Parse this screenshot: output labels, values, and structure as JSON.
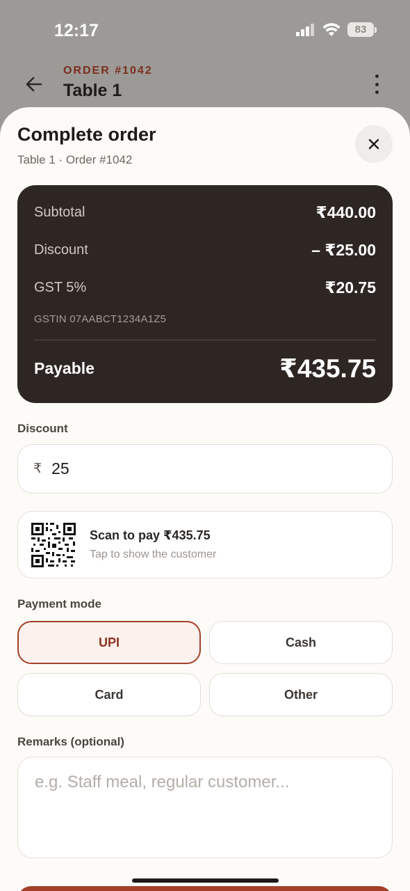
{
  "status_bar": {
    "time": "12:17",
    "battery": "83"
  },
  "header": {
    "order_tag": "ORDER #1042",
    "title": "Table 1"
  },
  "sheet": {
    "title": "Complete order",
    "subtitle": "Table 1 · Order #1042"
  },
  "summary": {
    "subtotal_label": "Subtotal",
    "subtotal_value": "₹440.00",
    "discount_label": "Discount",
    "discount_value": "– ₹25.00",
    "gst_label": "GST 5%",
    "gst_value": "₹20.75",
    "gstin": "GSTIN 07AABCT1234A1Z5",
    "payable_label": "Payable",
    "payable_value": "₹435.75"
  },
  "discount_field": {
    "label": "Discount",
    "prefix": "₹",
    "value": "25"
  },
  "qr": {
    "title": "Scan to pay ₹435.75",
    "subtitle": "Tap to show the customer"
  },
  "payment": {
    "label": "Payment mode",
    "modes": [
      "UPI",
      "Cash",
      "Card",
      "Other"
    ],
    "selected": "UPI"
  },
  "remarks": {
    "label": "Remarks (optional)",
    "placeholder": "e.g. Staff meal, regular customer..."
  },
  "colors": {
    "accent": "#a4402a",
    "summary_bg": "#2e2623",
    "sheet_bg": "#fdfbf7"
  }
}
